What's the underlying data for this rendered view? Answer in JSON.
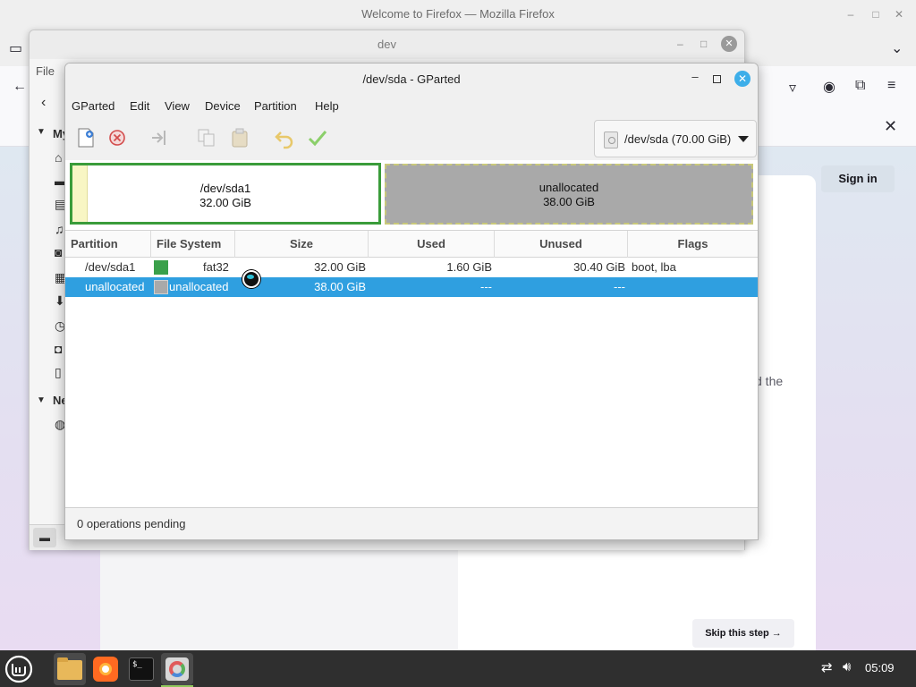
{
  "firefox": {
    "title": "Welcome to Firefox — Mozilla Firefox",
    "signin_label": "Sign in",
    "skip_label": "Skip this step →",
    "fragment_text": "d the"
  },
  "file_manager": {
    "title": "dev",
    "menu_file": "File",
    "sidebar_section_my": "My",
    "sidebar_section_net": "Ne"
  },
  "gparted": {
    "title": "/dev/sda - GParted",
    "menu": [
      "GParted",
      "Edit",
      "View",
      "Device",
      "Partition",
      "Help"
    ],
    "device_selector": "/dev/sda (70.00 GiB)",
    "map": {
      "seg1_name": "/dev/sda1",
      "seg1_size": "32.00 GiB",
      "seg2_name": "unallocated",
      "seg2_size": "38.00 GiB"
    },
    "columns": [
      "Partition",
      "File System",
      "Size",
      "Used",
      "Unused",
      "Flags"
    ],
    "rows": [
      {
        "partition": "/dev/sda1",
        "fs": "fat32",
        "size": "32.00 GiB",
        "used": "1.60 GiB",
        "unused": "30.40 GiB",
        "flags": "boot, lba",
        "fs_color": "#3aa04a",
        "selected": false
      },
      {
        "partition": "unallocated",
        "fs": "unallocated",
        "size": "38.00 GiB",
        "used": "---",
        "unused": "---",
        "flags": "",
        "fs_color": "#a9a9a9",
        "selected": true
      }
    ],
    "status": "0 operations pending"
  },
  "taskbar": {
    "clock": "05:09",
    "apps": [
      "mint-menu-icon",
      "files-icon",
      "firefox-icon",
      "terminal-icon",
      "gparted-icon"
    ]
  },
  "colors": {
    "selection": "#2f9fe0",
    "partition_border": "#3a9c3a",
    "unallocated": "#a9a9a9",
    "close_button": "#3daee9"
  }
}
